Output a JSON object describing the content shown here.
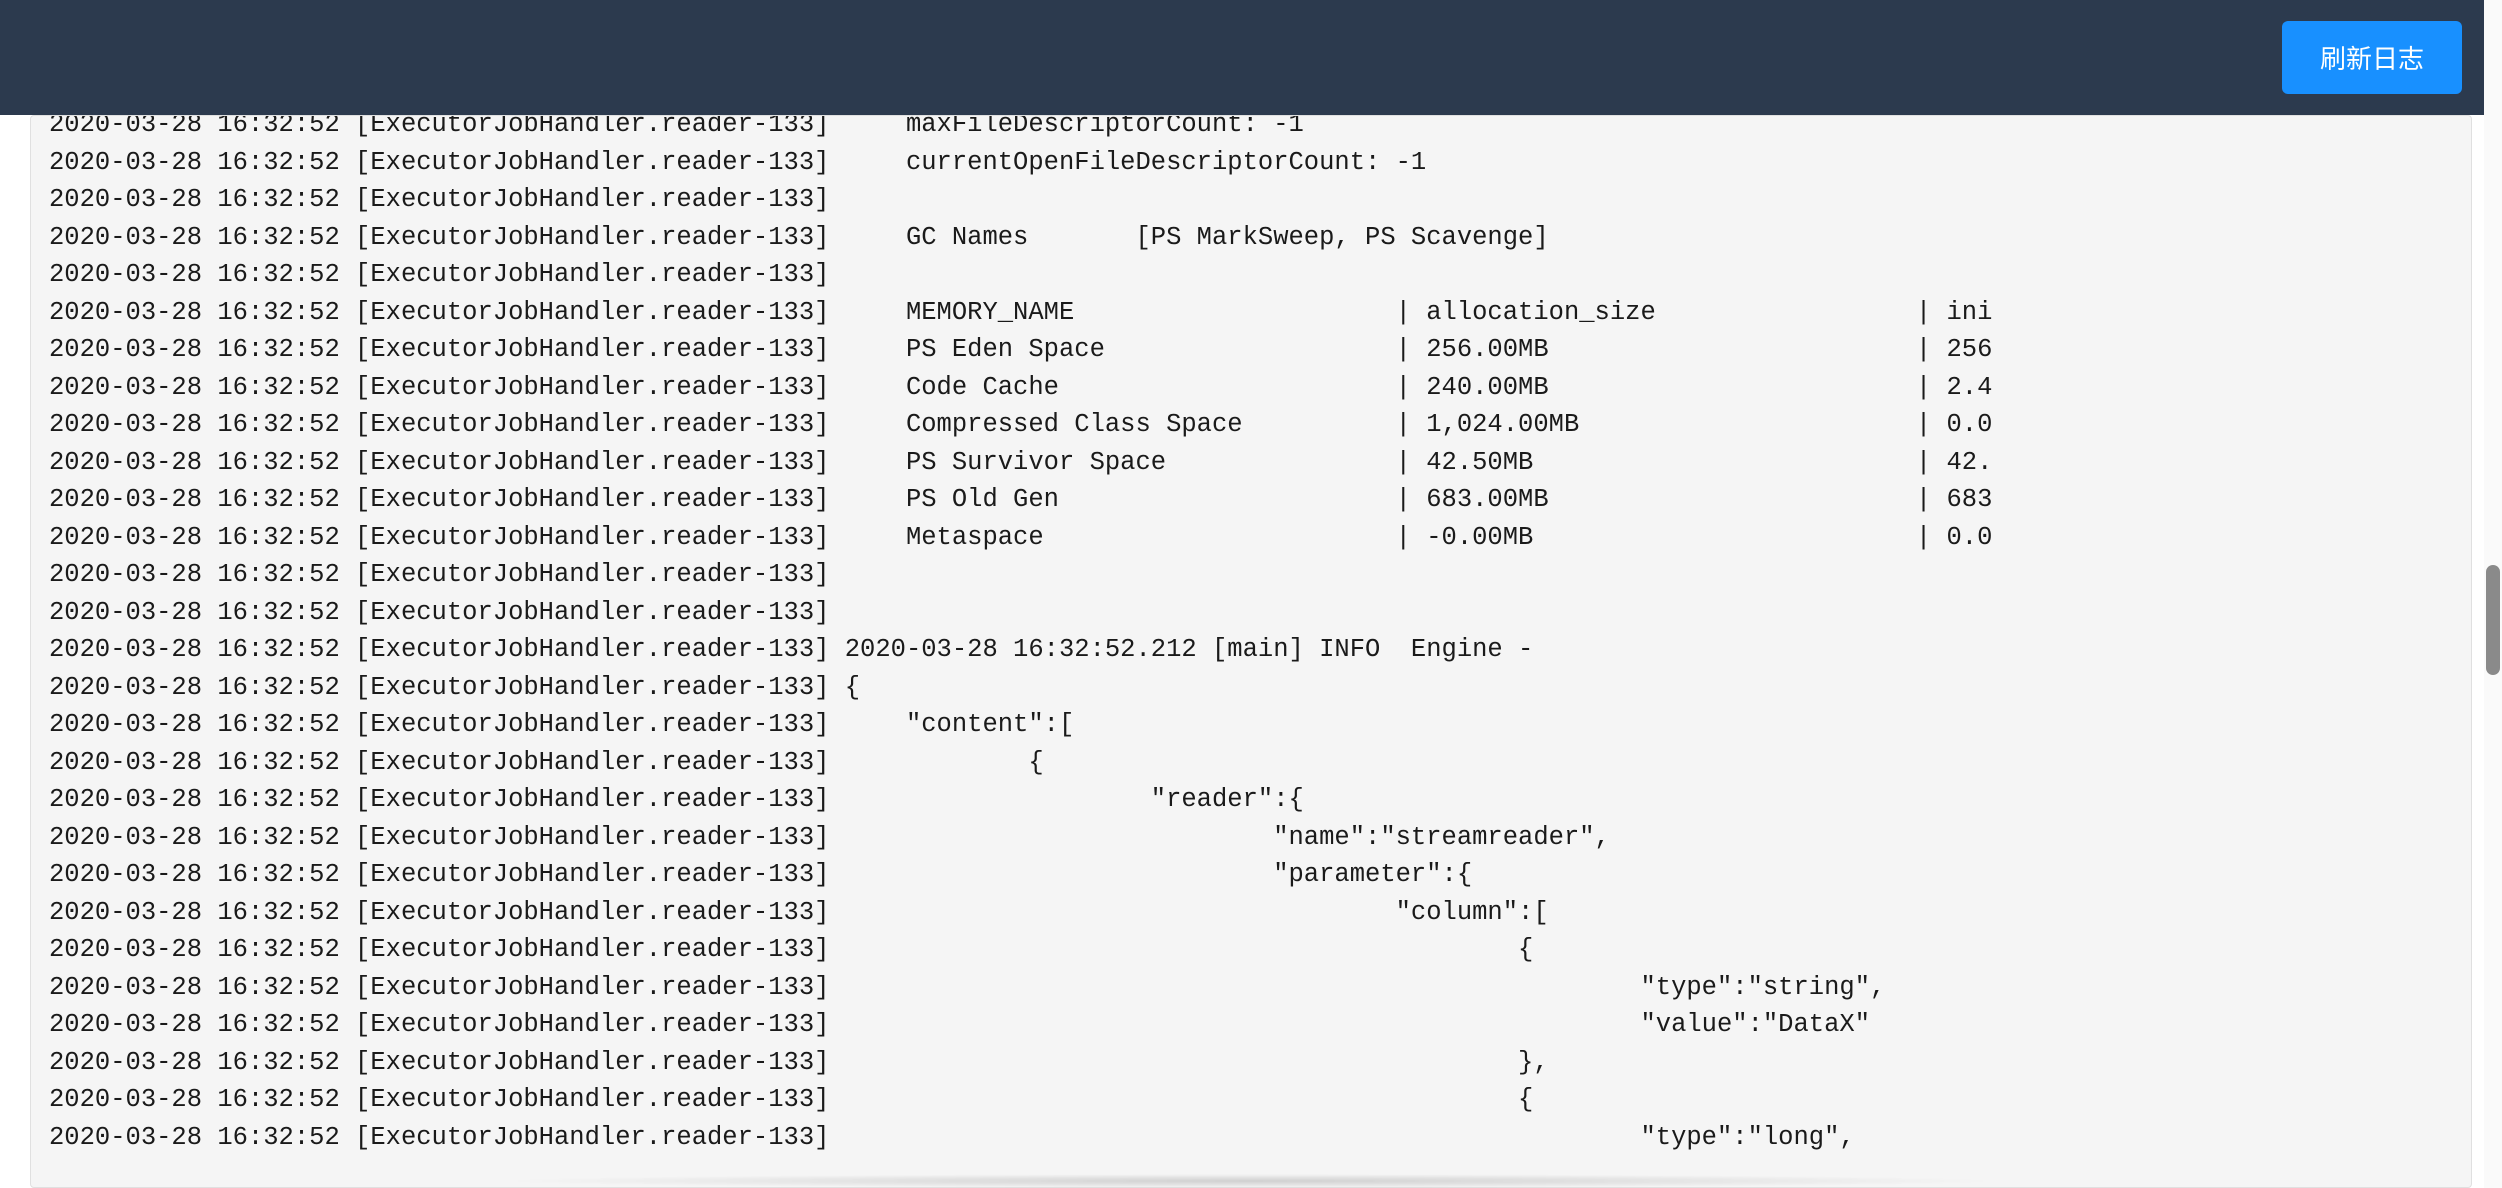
{
  "header": {
    "refresh_label": "刷新日志"
  },
  "log": {
    "prefix_ts": "2020-03-28 16:32:52",
    "prefix_source": "[ExecutorJobHandler.reader-133]",
    "lines": [
      "    maxFileDescriptorCount: -1",
      "    currentOpenFileDescriptorCount: -1",
      "",
      "    GC Names       [PS MarkSweep, PS Scavenge]",
      "",
      "    MEMORY_NAME                     | allocation_size                 | ini",
      "    PS Eden Space                   | 256.00MB                        | 256",
      "    Code Cache                      | 240.00MB                        | 2.4",
      "    Compressed Class Space          | 1,024.00MB                      | 0.0",
      "    PS Survivor Space               | 42.50MB                         | 42.",
      "    PS Old Gen                      | 683.00MB                        | 683",
      "    Metaspace                       | -0.00MB                         | 0.0",
      "",
      "",
      "2020-03-28 16:32:52.212 [main] INFO  Engine -",
      "{",
      "    \"content\":[",
      "            {",
      "                    \"reader\":{",
      "                            \"name\":\"streamreader\",",
      "                            \"parameter\":{",
      "                                    \"column\":[",
      "                                            {",
      "                                                    \"type\":\"string\",",
      "                                                    \"value\":\"DataX\"",
      "                                            },",
      "                                            {",
      "                                                    \"type\":\"long\","
    ]
  }
}
